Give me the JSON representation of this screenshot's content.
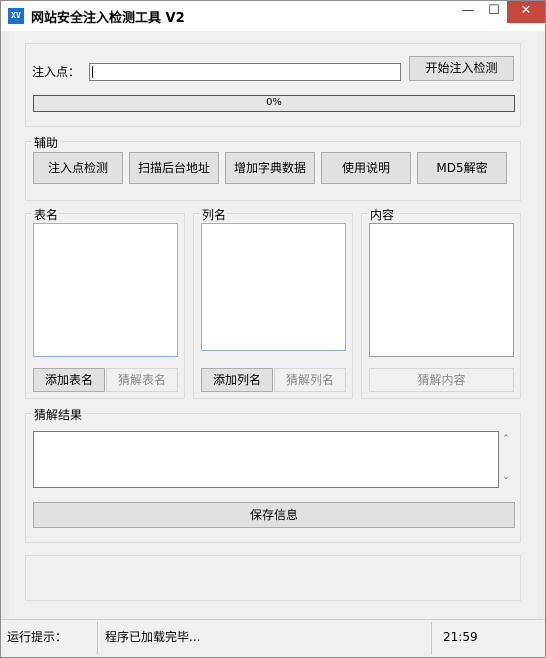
{
  "window": {
    "title": "网站安全注入检测工具 V2",
    "icon_text": "XV",
    "min_glyph": "—",
    "max_glyph": "☐",
    "close_glyph": "✕"
  },
  "inject": {
    "label": "注入点：",
    "value": "",
    "start_label": "开始注入检测",
    "progress_text": "0%",
    "progress_percent": 0
  },
  "assist": {
    "title": "辅助",
    "buttons": [
      "注入点检测",
      "扫描后台地址",
      "增加字典数据",
      "使用说明",
      "MD5解密"
    ]
  },
  "tables": {
    "title": "表名",
    "add_label": "添加表名",
    "guess_label": "猜解表名"
  },
  "columns": {
    "title": "列名",
    "add_label": "添加列名",
    "guess_label": "猜解列名"
  },
  "content": {
    "title": "内容",
    "guess_label": "猜解内容"
  },
  "result": {
    "title": "猜解结果",
    "save_label": "保存信息",
    "up_glyph": "⌃",
    "down_glyph": "⌄"
  },
  "status": {
    "label": "运行提示：",
    "message": "程序已加载完毕...",
    "time": "21:59"
  }
}
